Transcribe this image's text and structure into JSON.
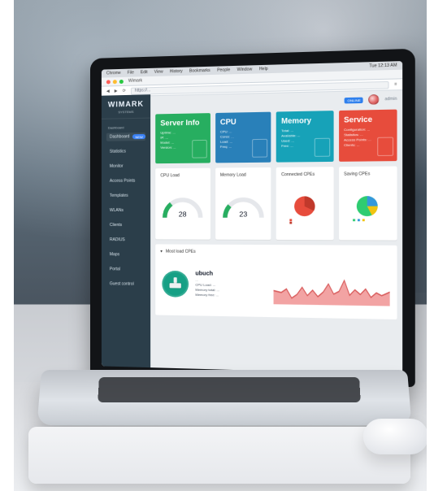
{
  "scene": {
    "browser": {
      "menu": [
        "Chrome",
        "File",
        "Edit",
        "View",
        "History",
        "Bookmarks",
        "People",
        "Window",
        "Help"
      ],
      "status_right": "Tue 12:13 AM",
      "tab_label": "Wimark",
      "url": "https://..."
    },
    "app": {
      "brand": {
        "logo": "WIMARK",
        "sub": "SYSTEMS"
      },
      "sidebar": {
        "section_title": "Dashboard",
        "items": [
          {
            "label": "Dashboard",
            "pill": "NEW"
          },
          {
            "label": "Statistics"
          },
          {
            "label": "Monitor"
          },
          {
            "label": "Access Points"
          },
          {
            "label": "Templates"
          },
          {
            "label": "WLANs"
          },
          {
            "label": "Clients"
          },
          {
            "label": "RADIUS"
          },
          {
            "label": "Maps"
          },
          {
            "label": "Portal"
          },
          {
            "label": "Guest control"
          }
        ]
      },
      "top": {
        "badge": "ONLINE",
        "user": "admin"
      },
      "cards": [
        {
          "title": "Server Info",
          "color": "#27ae60",
          "lines": [
            "Uptime: ...",
            "IP: ...",
            "Model: ...",
            "Version: ..."
          ]
        },
        {
          "title": "CPU",
          "color": "#2980b9",
          "lines": [
            "CPU: ...",
            "Cores: ...",
            "Load: ...",
            "Freq: ..."
          ]
        },
        {
          "title": "Memory",
          "color": "#17a2b8",
          "lines": [
            "Total: ...",
            "Available: ...",
            "Used: ...",
            "Free: ..."
          ]
        },
        {
          "title": "Service",
          "color": "#e74c3c",
          "lines": [
            "Configuration: ...",
            "Statistics: ...",
            "Access Points: ...",
            "Clients: ..."
          ]
        }
      ],
      "widgets": [
        {
          "title": "CPU Load",
          "type": "gauge",
          "value": 28,
          "color": "#27ae60"
        },
        {
          "title": "Memory Load",
          "type": "gauge",
          "value": 23,
          "color": "#27ae60"
        },
        {
          "title": "Connected CPEs",
          "type": "pie",
          "colors": [
            "#e74c3c",
            "#c0392b"
          ]
        },
        {
          "title": "Saving CPEs",
          "type": "pie",
          "colors": [
            "#2ecc71",
            "#3498db",
            "#f1c40f"
          ]
        }
      ],
      "bottom": {
        "title": "Most load CPEs",
        "device": {
          "name": "ubuch",
          "meta": "...",
          "lines": [
            "CPU Load: ...",
            "Memory total: ...",
            "Memory free: ..."
          ]
        }
      }
    },
    "colors": {
      "sidebar_bg": "#2b3e4a",
      "main_bg": "#e9ecef",
      "chart_fill": "#f2a3a3",
      "chart_line": "#d95d5d"
    }
  }
}
